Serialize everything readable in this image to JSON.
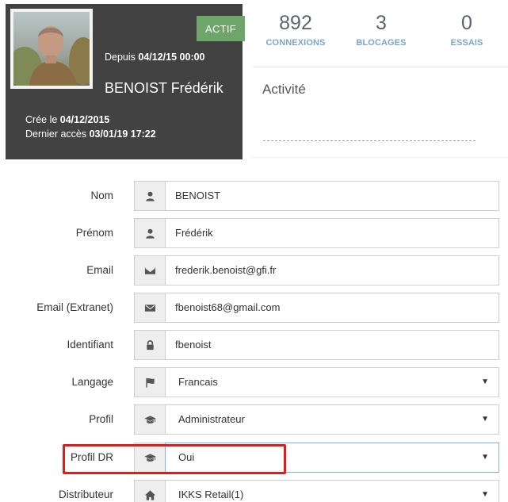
{
  "profile": {
    "status_badge": "ACTIF",
    "since_label": "Depuis",
    "since_value": "04/12/15 00:00",
    "full_name": "BENOIST Frédérik",
    "created_label": "Crée le",
    "created_value": "04/12/2015",
    "last_access_label": "Dernier accès",
    "last_access_value": "03/01/19 17:22",
    "badge_color": "#6fa56a",
    "card_color": "#424242"
  },
  "stats": [
    {
      "value": "892",
      "label": "CONNEXIONS"
    },
    {
      "value": "3",
      "label": "BLOCAGES"
    },
    {
      "value": "0",
      "label": "ESSAIS"
    }
  ],
  "activity": {
    "title": "Activité"
  },
  "form": {
    "nom": {
      "label": "Nom",
      "value": "BENOIST",
      "icon": "user-icon"
    },
    "prenom": {
      "label": "Prénom",
      "value": "Frédérik",
      "icon": "user-icon"
    },
    "email": {
      "label": "Email",
      "value": "frederik.benoist@gfi.fr",
      "icon": "envelope-icon"
    },
    "email_extranet": {
      "label": "Email (Extranet)",
      "value": "fbenoist68@gmail.com",
      "icon": "envelope-icon"
    },
    "identifiant": {
      "label": "Identifiant",
      "value": "fbenoist",
      "icon": "lock-icon"
    },
    "langage": {
      "label": "Langage",
      "value": "Francais",
      "icon": "flag-icon"
    },
    "profil": {
      "label": "Profil",
      "value": "Administrateur",
      "icon": "graduation-cap-icon"
    },
    "profil_dr": {
      "label": "Profil DR",
      "value": "Oui",
      "icon": "graduation-cap-icon"
    },
    "distributeur": {
      "label": "Distributeur",
      "value": "IKKS Retail(1)",
      "icon": "home-icon"
    }
  },
  "colors": {
    "highlight": "#d9201f",
    "stat_label": "#7da5c8"
  }
}
